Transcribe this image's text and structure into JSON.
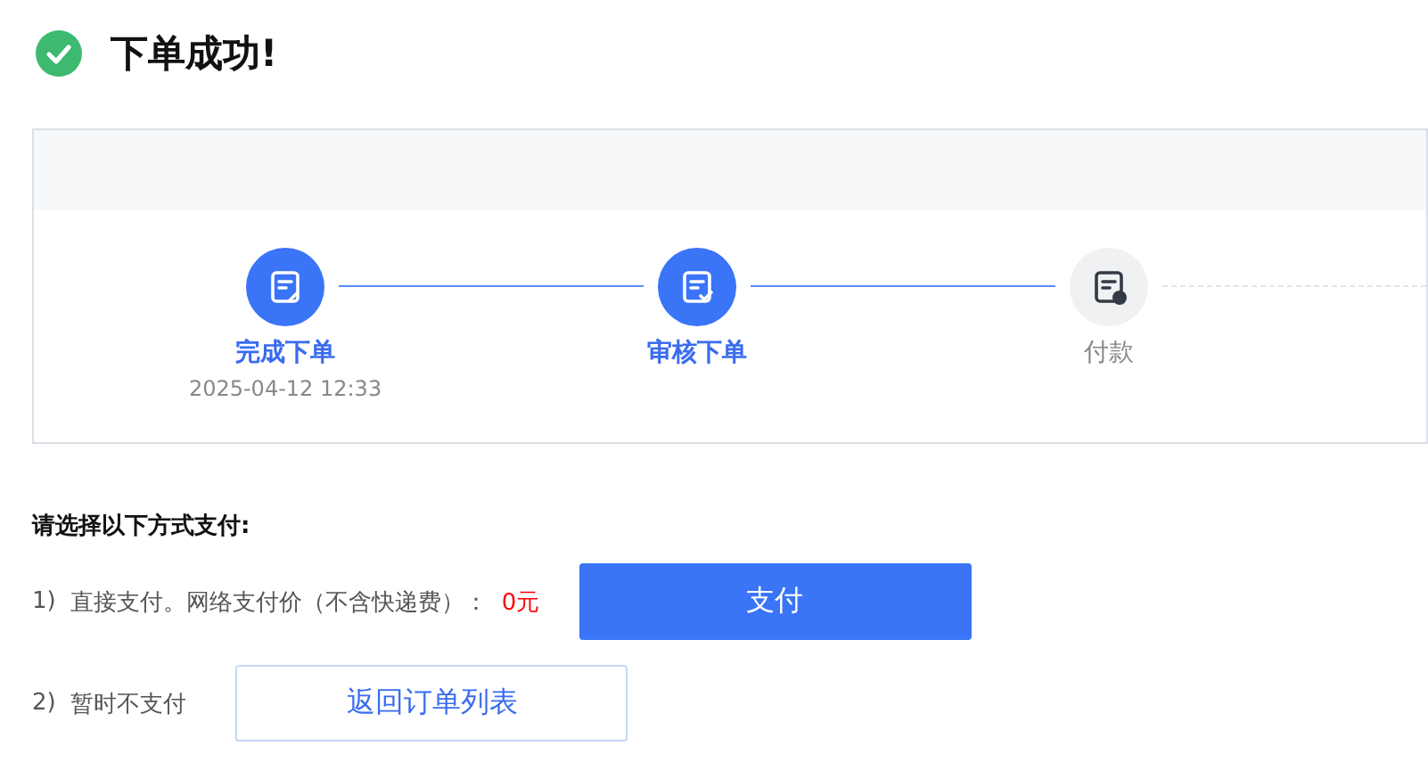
{
  "title": "下单成功!",
  "steps": [
    {
      "label": "完成下单",
      "time": "2025-04-12 12:33",
      "done": true,
      "kind": "doc"
    },
    {
      "label": "审核下单",
      "done": true,
      "kind": "check"
    },
    {
      "label": "付款",
      "done": false,
      "kind": "money"
    }
  ],
  "steps_continue": true,
  "payment_heading": "请选择以下方式支付:",
  "options": [
    {
      "number": "1)",
      "text": "直接支付。网络支付价（不含快递费）：",
      "amount": "0元",
      "button": "支付",
      "kind": "primary"
    },
    {
      "number": "2)",
      "text": "暂时不支付",
      "button": "返回订单列表",
      "kind": "plain"
    }
  ]
}
